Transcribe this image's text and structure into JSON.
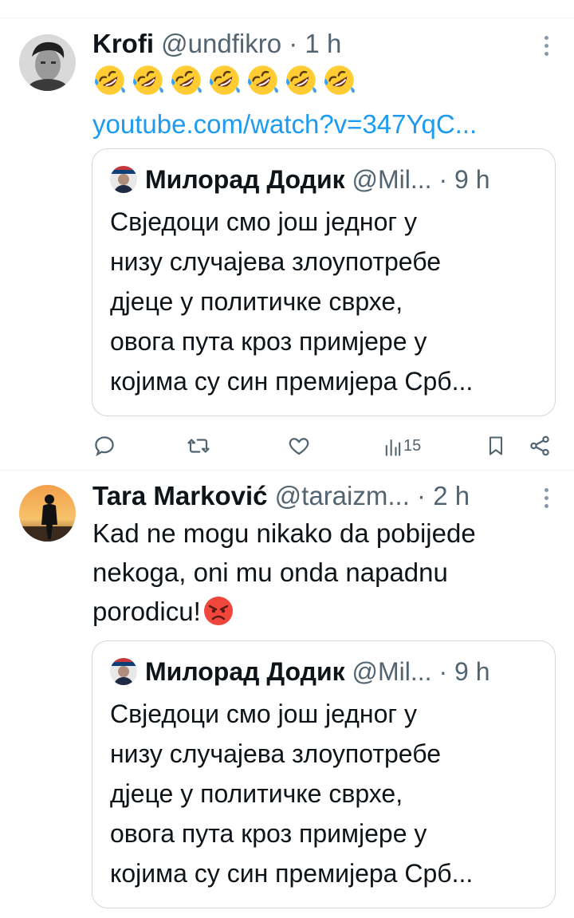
{
  "tweets": [
    {
      "name": "Krofi",
      "handle": "@undfikro",
      "dot": "·",
      "time": "1 h",
      "emoji_count": 7,
      "link": "youtube.com/watch?v=347YqC...",
      "quote": {
        "name": "Милорад Додик",
        "handle": "@Mil...",
        "dot": "·",
        "time": "9 h",
        "text": "Свједоци смо још једног у\nнизу случајева злоупотребе\nдјеце у политичке сврхе,\nовога пута кроз примјере у\nкојима су син премијера Срб..."
      },
      "actions": {
        "views": "15"
      }
    },
    {
      "name": "Tara Marković",
      "handle": "@taraizm...",
      "dot": "·",
      "time": "2 h",
      "text": "Kad ne mogu nikako da pobijede\nnekoga, oni mu onda napadnu\nporodicu!",
      "quote": {
        "name": "Милорад Додик",
        "handle": "@Mil...",
        "dot": "·",
        "time": "9 h",
        "text": "Свједоци смо још једног у\nнизу случајева злоупотребе\nдјеце у политичке сврхе,\nовога пута кроз примјере у\nкојима су син премијера Срб..."
      }
    }
  ],
  "colors": {
    "link": "#1d9bf0",
    "secondary": "#536471",
    "border": "#cfd9de"
  }
}
